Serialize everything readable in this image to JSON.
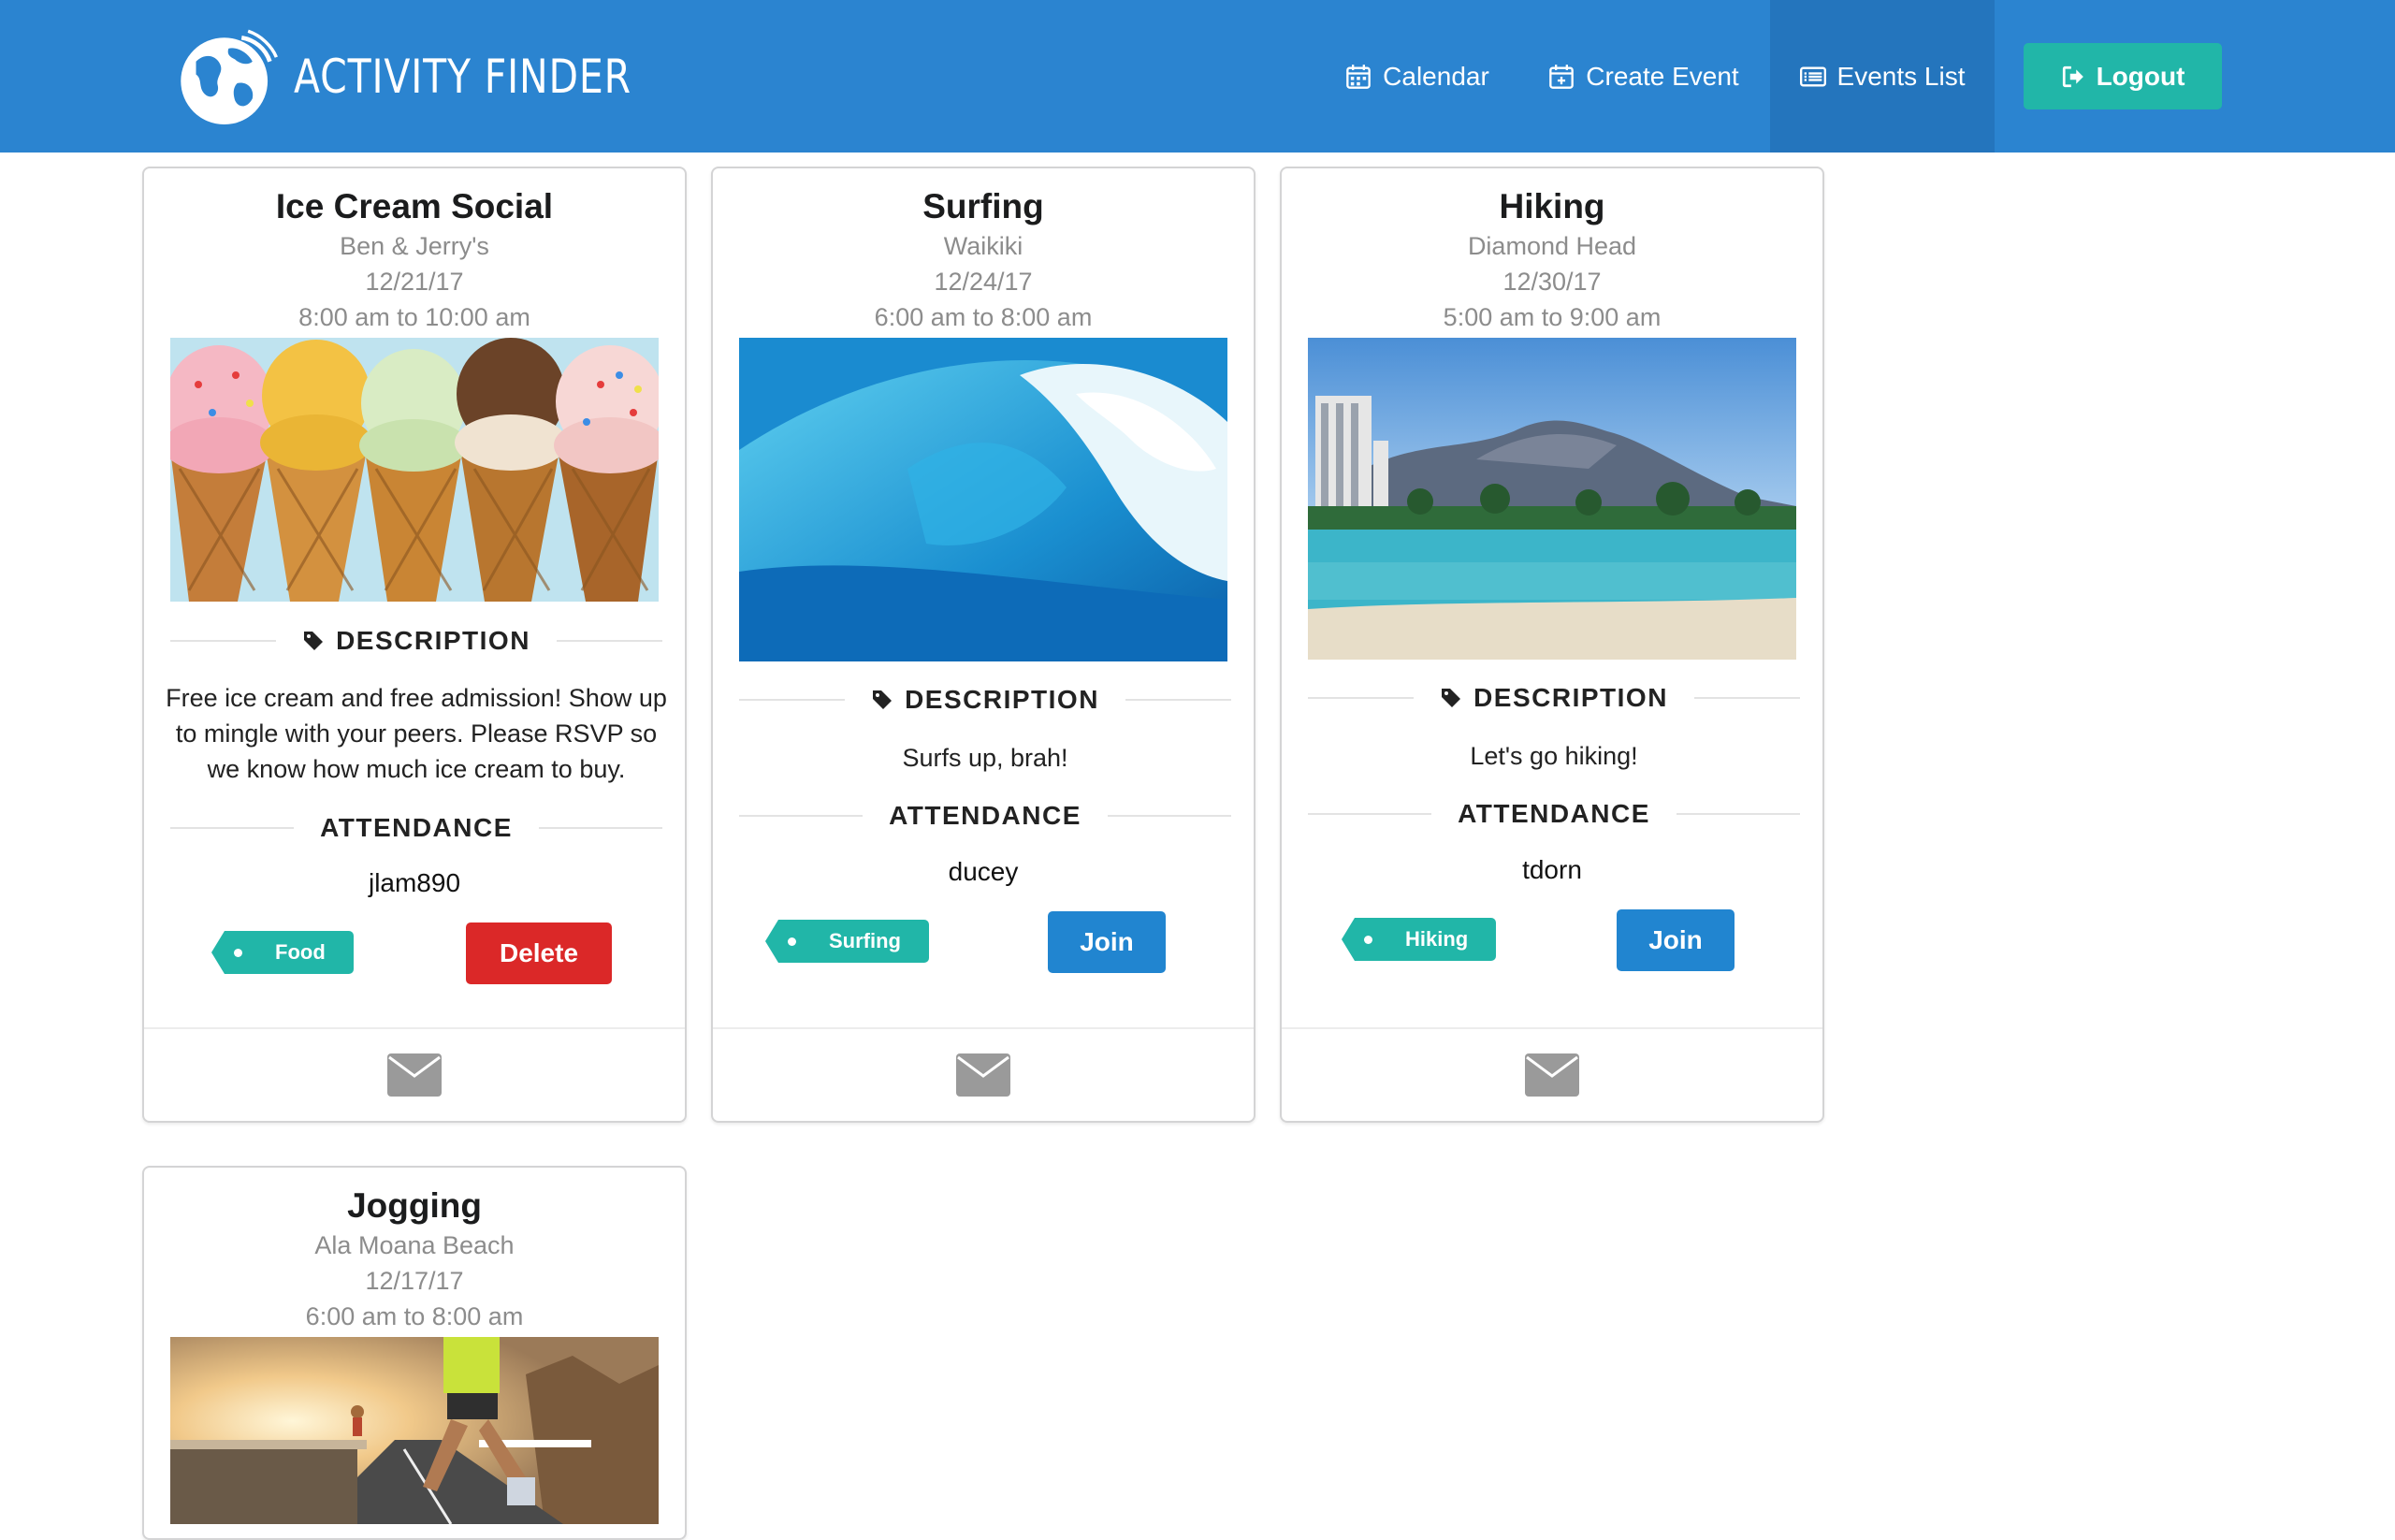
{
  "nav": {
    "brand": "ACTIVITY FINDER",
    "items": [
      {
        "label": "Calendar",
        "icon": "calendar-icon"
      },
      {
        "label": "Create Event",
        "icon": "calendar-plus-icon"
      },
      {
        "label": "Events List",
        "icon": "list-icon",
        "active": true
      }
    ],
    "logout": "Logout"
  },
  "colors": {
    "navbar": "#2b84d0",
    "navbar_active": "#2475bd",
    "teal": "#21b6a8",
    "delete": "#db2828",
    "join": "#2185d0"
  },
  "sections": {
    "description": "DESCRIPTION",
    "attendance": "ATTENDANCE"
  },
  "events": [
    {
      "title": "Ice Cream Social",
      "location": "Ben & Jerry's",
      "date": "12/21/17",
      "time": "8:00 am to 10:00 am",
      "image": "ice-cream-cones",
      "description": "Free ice cream and free admission! Show up to mingle with your peers. Please RSVP so we know how much ice cream to buy.",
      "attendees": "jlam890",
      "tag": "Food",
      "action": "Delete"
    },
    {
      "title": "Surfing",
      "location": "Waikiki",
      "date": "12/24/17",
      "time": "6:00 am to 8:00 am",
      "image": "ocean-wave",
      "description": "Surfs up, brah!",
      "attendees": "ducey",
      "tag": "Surfing",
      "action": "Join"
    },
    {
      "title": "Hiking",
      "location": "Diamond Head",
      "date": "12/30/17",
      "time": "5:00 am to 9:00 am",
      "image": "diamond-head-beach",
      "description": "Let's go hiking!",
      "attendees": "tdorn",
      "tag": "Hiking",
      "action": "Join"
    },
    {
      "title": "Jogging",
      "location": "Ala Moana Beach",
      "date": "12/17/17",
      "time": "6:00 am to 8:00 am",
      "image": "runners-on-road"
    }
  ]
}
